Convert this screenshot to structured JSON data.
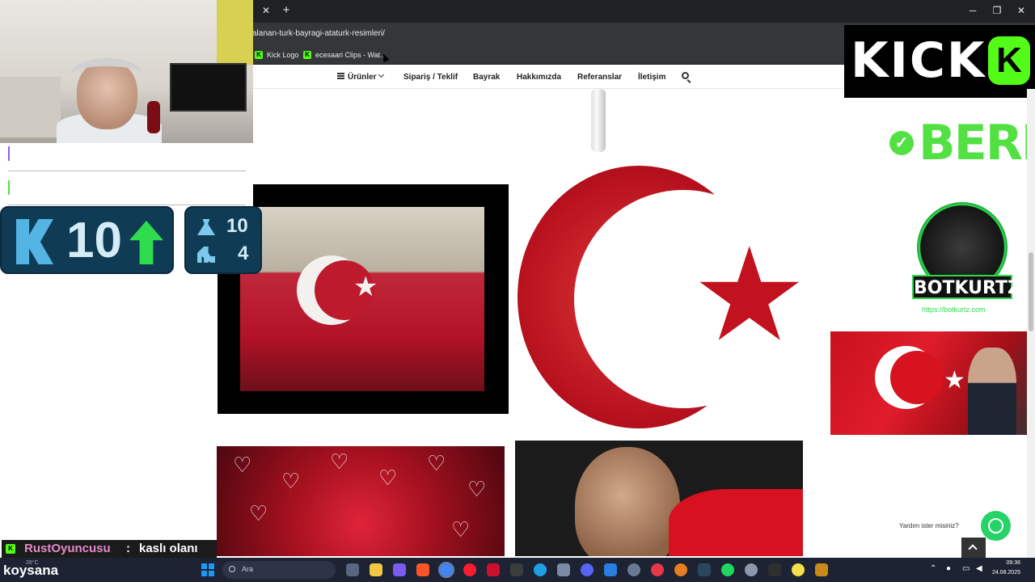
{
  "browser": {
    "url": "alanan-turk-bayragi-ataturk-resimleri/",
    "bookmarks": [
      {
        "label": "Kick Logo"
      },
      {
        "label": "ecesaari Clips - Wat..."
      }
    ]
  },
  "site_nav": {
    "items": [
      "Ürünler",
      "Sipariş / Teklif",
      "Bayrak",
      "Hakkımızda",
      "Referanslar",
      "İletişim"
    ]
  },
  "kick_widget": {
    "follower_count": "10",
    "stat_top": "10",
    "stat_bottom": "4"
  },
  "overlay": {
    "kick_logo_text": "KICK",
    "berk_text": "BERK",
    "bot_label": "BOTKURTZ",
    "bot_url": "https://botkurtz.com"
  },
  "chat": {
    "username": "RustOyuncusu",
    "separator": ":",
    "message": "kaslı olanı"
  },
  "page": {
    "help_text": "Yardım ister misiniz?"
  },
  "taskbar": {
    "weather": "26°C",
    "streamer_name": "koysana",
    "search_placeholder": "Ara",
    "time": "09:36",
    "date": "24.08.2025"
  },
  "colors": {
    "kick_green": "#53fc18",
    "chrome_dark": "#202124",
    "taskbar_bg": "#1d2333"
  }
}
